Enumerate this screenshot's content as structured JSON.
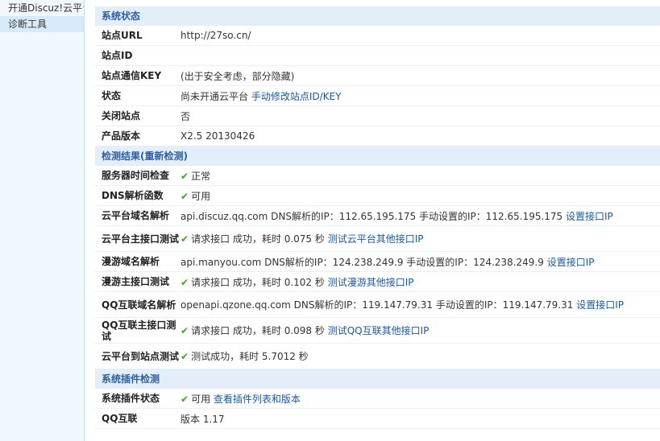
{
  "sidebar": {
    "items": [
      {
        "label": "开通Discuz!云平台"
      },
      {
        "label": "诊断工具"
      }
    ]
  },
  "site_status": {
    "header": "系统状态",
    "url_label": "站点URL",
    "url_value": "http://27so.cn/",
    "id_label": "站点ID",
    "id_value": "",
    "key_label": "站点通信KEY",
    "key_value": "(出于安全考虑，部分隐藏)",
    "state_label": "状态",
    "state_value": "尚未开通云平台",
    "state_link": "手动修改站点ID/KEY",
    "closed_label": "关闭站点",
    "closed_value": "否",
    "version_label": "产品版本",
    "version_value": "X2.5 20130426"
  },
  "checks": {
    "header": "检测结果(重新检测)",
    "time_label": "服务器时间检查",
    "time_value": "正常",
    "dns_label": "DNS解析函数",
    "dns_value": "可用",
    "cloud_dns_label": "云平台域名解析",
    "cloud_dns_value": "api.discuz.qq.com DNS解析的IP：112.65.195.175 手动设置的IP：112.65.195.175",
    "cloud_dns_link": "设置接口IP",
    "cloud_api_label": "云平台主接口测试",
    "cloud_api_value": "请求接口 成功，耗时 0.075 秒",
    "cloud_api_link": "测试云平台其他接口IP",
    "manyou_dns_label": "漫游域名解析",
    "manyou_dns_value": "api.manyou.com DNS解析的IP：124.238.249.9 手动设置的IP：124.238.249.9",
    "manyou_dns_link": "设置接口IP",
    "manyou_api_label": "漫游主接口测试",
    "manyou_api_value": "请求接口 成功，耗时 0.102 秒",
    "manyou_api_link": "测试漫游其他接口IP",
    "qq_dns_label": "QQ互联域名解析",
    "qq_dns_value": "openapi.qzone.qq.com DNS解析的IP：119.147.79.31 手动设置的IP：119.147.79.31",
    "qq_dns_link": "设置接口IP",
    "qq_api_label": "QQ互联主接口测试",
    "qq_api_value": "请求接口 成功，耗时 0.098 秒",
    "qq_api_link": "测试QQ互联其他接口IP",
    "cloud_site_label": "云平台到站点测试",
    "cloud_site_value": "测试成功，耗时 5.7012 秒"
  },
  "plugins": {
    "header": "系统插件检测",
    "status_label": "系统插件状态",
    "status_value": "可用",
    "status_link": "查看插件列表和版本",
    "qq_label": "QQ互联",
    "qq_value": "版本 1.17"
  },
  "icons": {
    "ok": "checkmark-icon",
    "ok_color": "#44a128",
    "link_color": "#1a5aa0",
    "header_bg": "#e3eef9"
  }
}
